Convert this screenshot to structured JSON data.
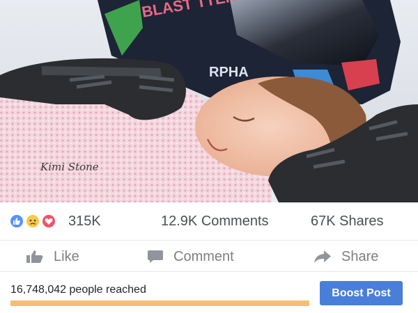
{
  "photo": {
    "watermark": "Kimi Stone"
  },
  "reactions": {
    "icons": [
      "like-icon",
      "sad-icon",
      "love-icon"
    ],
    "count": "315K",
    "comments": "12.9K Comments",
    "shares": "67K Shares"
  },
  "actions": {
    "like": "Like",
    "comment": "Comment",
    "share": "Share"
  },
  "reach": {
    "text": "16,748,042 people reached",
    "progress": 1.0
  },
  "boost": {
    "label": "Boost Post"
  },
  "colors": {
    "like_blue": "#5890ff",
    "love_red": "#f25268",
    "sad_yellow": "#f7c948",
    "boost_blue": "#4a7fd9",
    "reach_bar": "#f5be77"
  }
}
